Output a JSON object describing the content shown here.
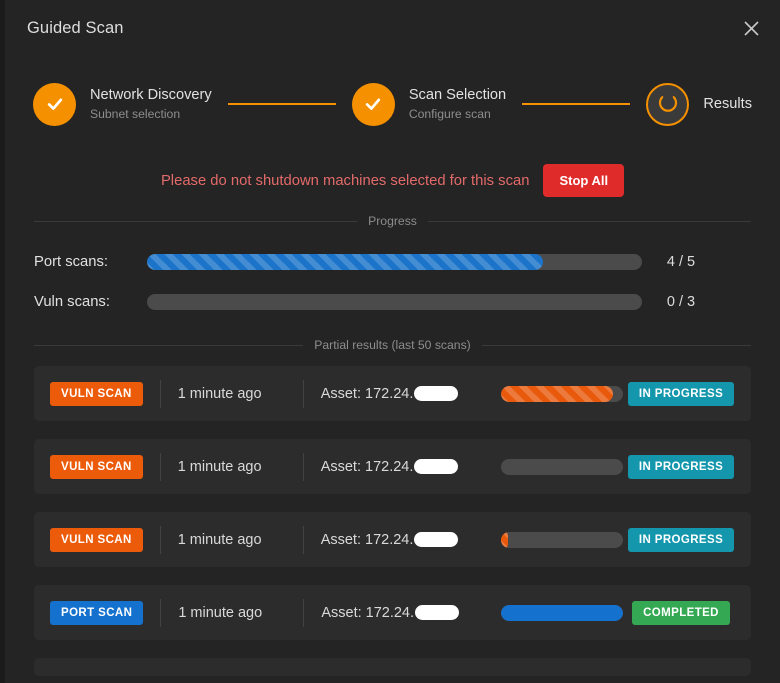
{
  "window": {
    "title": "Guided Scan",
    "close_icon": "close-icon"
  },
  "stepper": {
    "steps": [
      {
        "title": "Network Discovery",
        "subtitle": "Subnet selection",
        "state": "complete",
        "icon": "check-icon"
      },
      {
        "title": "Scan Selection",
        "subtitle": "Configure scan",
        "state": "complete",
        "icon": "check-icon"
      },
      {
        "title": "Results",
        "subtitle": "",
        "state": "active",
        "icon": "spinner-icon"
      }
    ]
  },
  "warning": {
    "text": "Please do not shutdown machines selected for this scan",
    "stop_all_label": "Stop All",
    "text_color": "#e36a6a",
    "button_color": "#e02b2b"
  },
  "progress_section": {
    "divider_label": "Progress",
    "rows": [
      {
        "label": "Port scans:",
        "percent": 80,
        "count": "4 / 5",
        "style": "striped-blue"
      },
      {
        "label": "Vuln scans:",
        "percent": 0,
        "count": "0 / 3",
        "style": "empty"
      }
    ]
  },
  "results_section": {
    "divider_label": "Partial results (last 50 scans)",
    "rows": [
      {
        "type_label": "VULN SCAN",
        "type_color": "#eb5b0a",
        "time": "1 minute ago",
        "asset_prefix": "Asset: 172.24.",
        "asset_redacted": true,
        "percent": 92,
        "bar_style": "striped-orange",
        "status_label": "IN PROGRESS",
        "status_color": "#1496ad"
      },
      {
        "type_label": "VULN SCAN",
        "type_color": "#eb5b0a",
        "time": "1 minute ago",
        "asset_prefix": "Asset: 172.24.",
        "asset_redacted": true,
        "percent": 0,
        "bar_style": "empty",
        "status_label": "IN PROGRESS",
        "status_color": "#1496ad"
      },
      {
        "type_label": "VULN SCAN",
        "type_color": "#eb5b0a",
        "time": "1 minute ago",
        "asset_prefix": "Asset: 172.24.",
        "asset_redacted": true,
        "percent": 6,
        "bar_style": "striped-orange",
        "status_label": "IN PROGRESS",
        "status_color": "#1496ad"
      },
      {
        "type_label": "PORT SCAN",
        "type_color": "#1571ce",
        "time": "1 minute ago",
        "asset_prefix": "Asset: 172.24.",
        "asset_redacted": true,
        "percent": 100,
        "bar_style": "solid-blue",
        "status_label": "COMPLETED",
        "status_color": "#34a853"
      }
    ]
  },
  "theme": {
    "background": "#242424",
    "row_background": "#2c2c2c",
    "accent_orange": "#f59100",
    "track_gray": "#4b4b4b"
  }
}
